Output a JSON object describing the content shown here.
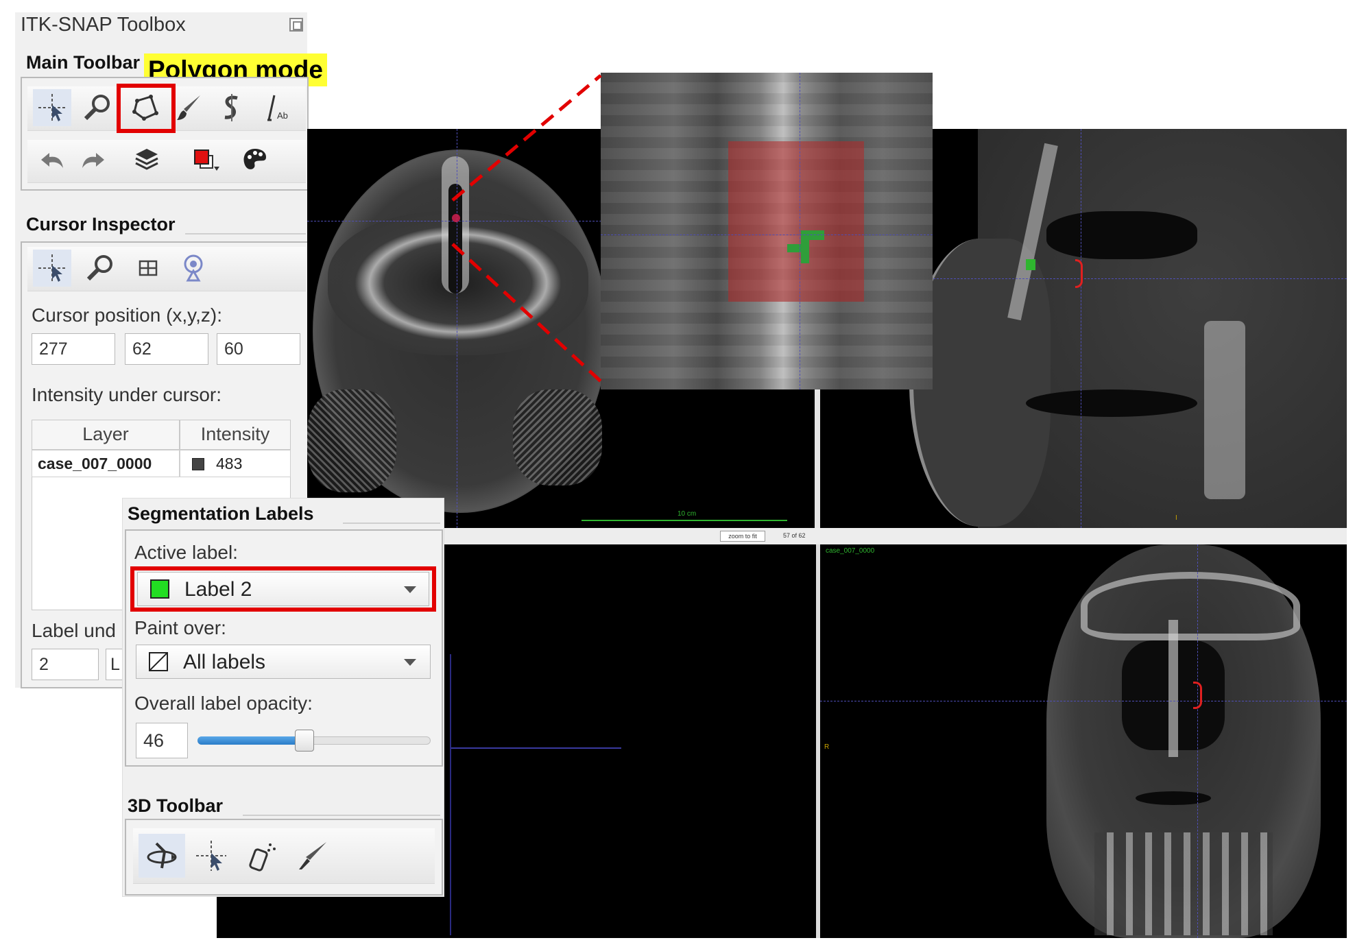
{
  "toolbox": {
    "title": "ITK-SNAP Toolbox",
    "main_toolbar": {
      "title": "Main Toolbar",
      "annotation": "Polygon mode",
      "row1_icons": [
        "crosshair-icon",
        "zoom-icon",
        "polygon-icon",
        "paintbrush-icon",
        "snake-icon",
        "annotation-icon"
      ],
      "row2_icons": [
        "undo-icon",
        "redo-icon",
        "layers-icon",
        "label-color-icon",
        "palette-icon"
      ],
      "active_tool": "crosshair-icon",
      "highlighted_tool": "polygon-icon"
    },
    "cursor_inspector": {
      "title": "Cursor Inspector",
      "icons": [
        "crosshair-icon",
        "zoom-icon",
        "grid-icon",
        "probe-icon"
      ],
      "position_label": "Cursor position (x,y,z):",
      "x": "277",
      "y": "62",
      "z": "60",
      "intensity_label": "Intensity under cursor:",
      "table_headers": [
        "Layer",
        "Intensity"
      ],
      "rows": [
        {
          "layer": "case_007_0000",
          "intensity": "483"
        }
      ],
      "label_under_label": "Label und",
      "label_under_value": "2",
      "label_under_name": "L"
    }
  },
  "segmentation": {
    "title": "Segmentation Labels",
    "active_label_title": "Active label:",
    "active_label": "Label 2",
    "active_label_color": "#22dd22",
    "paint_over_title": "Paint over:",
    "paint_over": "All labels",
    "opacity_title": "Overall label opacity:",
    "opacity_value": "46",
    "opacity_fraction": 0.46
  },
  "toolbar_3d": {
    "title": "3D Toolbar",
    "icons": [
      "rotate-3d-icon",
      "crosshair-3d-icon",
      "spray-icon",
      "scalpel-icon"
    ]
  },
  "viewers": {
    "axial_scale": "10 cm",
    "zoom_button": "zoom to fit",
    "slice_info": "57 of 62",
    "coronal_layer_name": "case_007_0000",
    "coronal_side_marker": "R",
    "sagittal_bottom_marker": "I"
  },
  "colors": {
    "highlight_red": "#e20000",
    "highlight_yellow": "#ffff33",
    "segmentation_red": "#b03030",
    "segmentation_green": "#2f9e3a"
  }
}
